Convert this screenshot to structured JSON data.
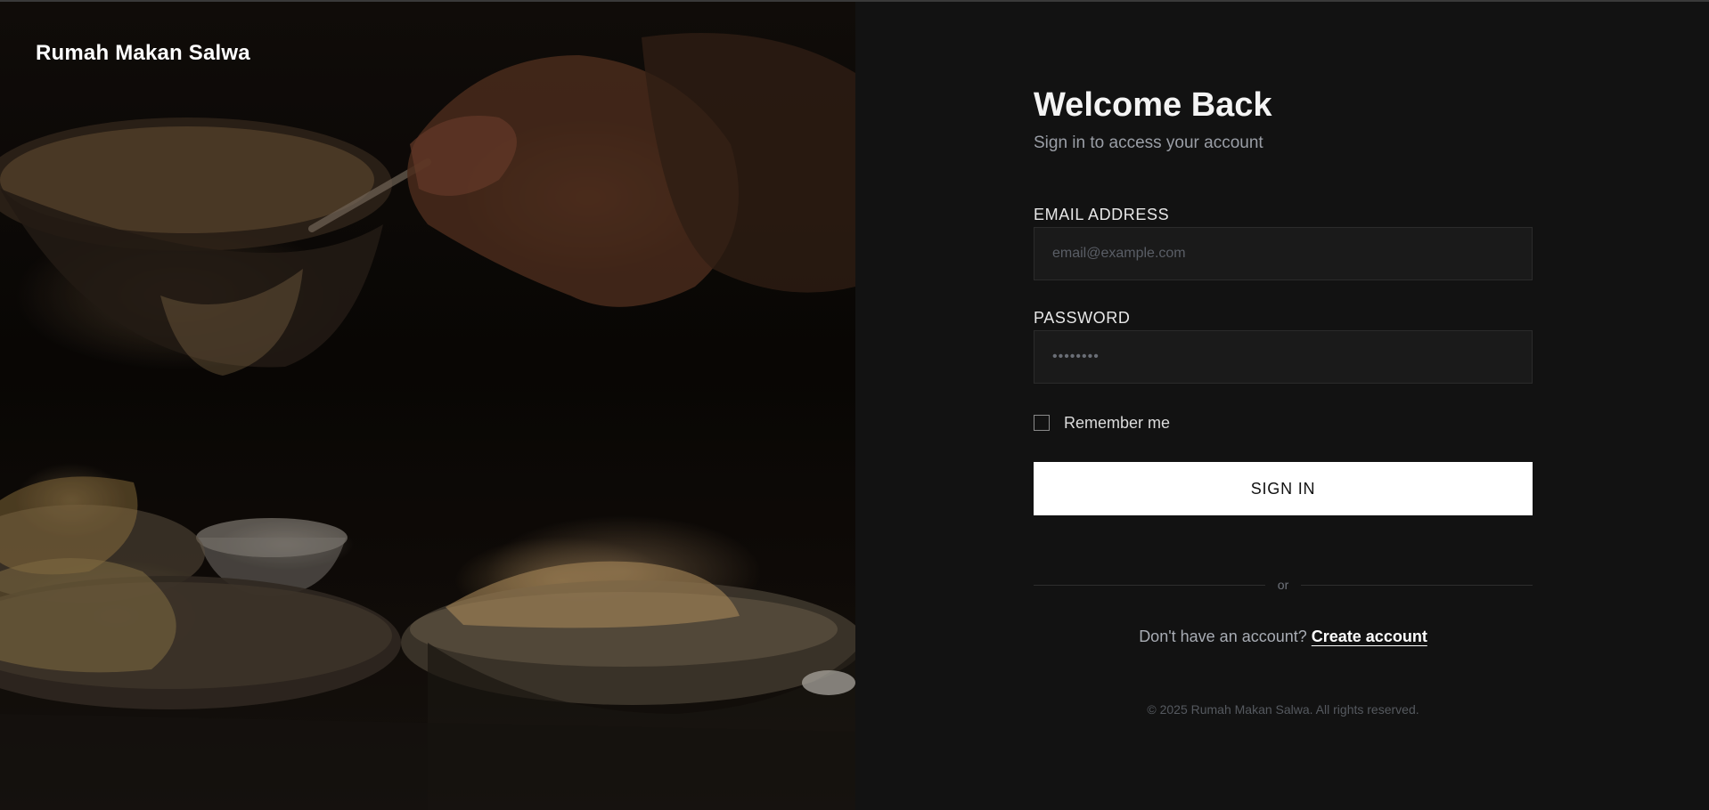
{
  "brand": {
    "name": "Rumah Makan Salwa"
  },
  "form": {
    "title": "Welcome Back",
    "subtitle": "Sign in to access your account",
    "email": {
      "label": "EMAIL ADDRESS",
      "placeholder": "email@example.com",
      "value": ""
    },
    "password": {
      "label": "PASSWORD",
      "placeholder": "••••••••",
      "value": ""
    },
    "remember": {
      "label": "Remember me",
      "checked": false
    },
    "submit_label": "SIGN IN",
    "divider_text": "or",
    "signup_prompt": "Don't have an account?",
    "signup_link": "Create account",
    "copyright": "© 2025 Rumah Makan Salwa. All rights reserved."
  },
  "colors": {
    "background": "#121212",
    "input_bg": "#1a1a1a",
    "button_bg": "#ffffff",
    "button_text": "#111111"
  }
}
